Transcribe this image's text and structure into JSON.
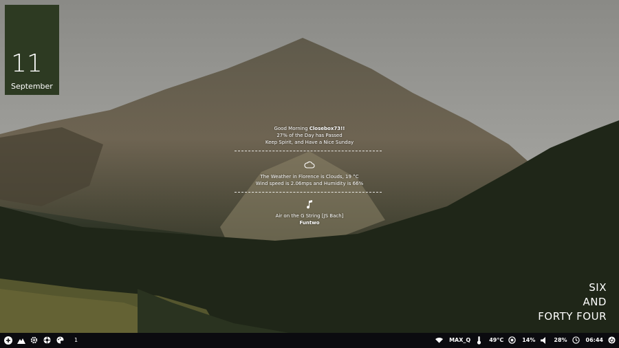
{
  "date": {
    "day": "11",
    "month": "September"
  },
  "greeting": {
    "line1_prefix": "Good Morning ",
    "line1_user": "Closebox73!!",
    "line2": "27% of the Day has Passed",
    "line3": "Keep Spirit, and Have a Nice Sunday"
  },
  "weather": {
    "icon": "cloud-icon",
    "line1": "The Weather in Florence is Clouds, 19 °C",
    "line2": "Wind speed is 2.06mps and Humidity is 66%"
  },
  "music": {
    "icon": "music-note-icon",
    "title": "Air on the G String [JS Bach]",
    "artist": "Funtwo"
  },
  "clock_words": [
    "SIX",
    "AND",
    "FORTY FOUR"
  ],
  "taskbar": {
    "left_icons": [
      "plus-circle-icon",
      "mountain-icon",
      "gear-icon",
      "aperture-icon",
      "palette-icon"
    ],
    "workspace": "1",
    "wifi": "MAX_Q",
    "temp": "49°C",
    "cpu": "14%",
    "volume": "28%",
    "time": "06:44",
    "power_icon": "power-icon"
  },
  "colors": {
    "date_card": "#2d3a22",
    "taskbar": "#0b0b0f"
  }
}
